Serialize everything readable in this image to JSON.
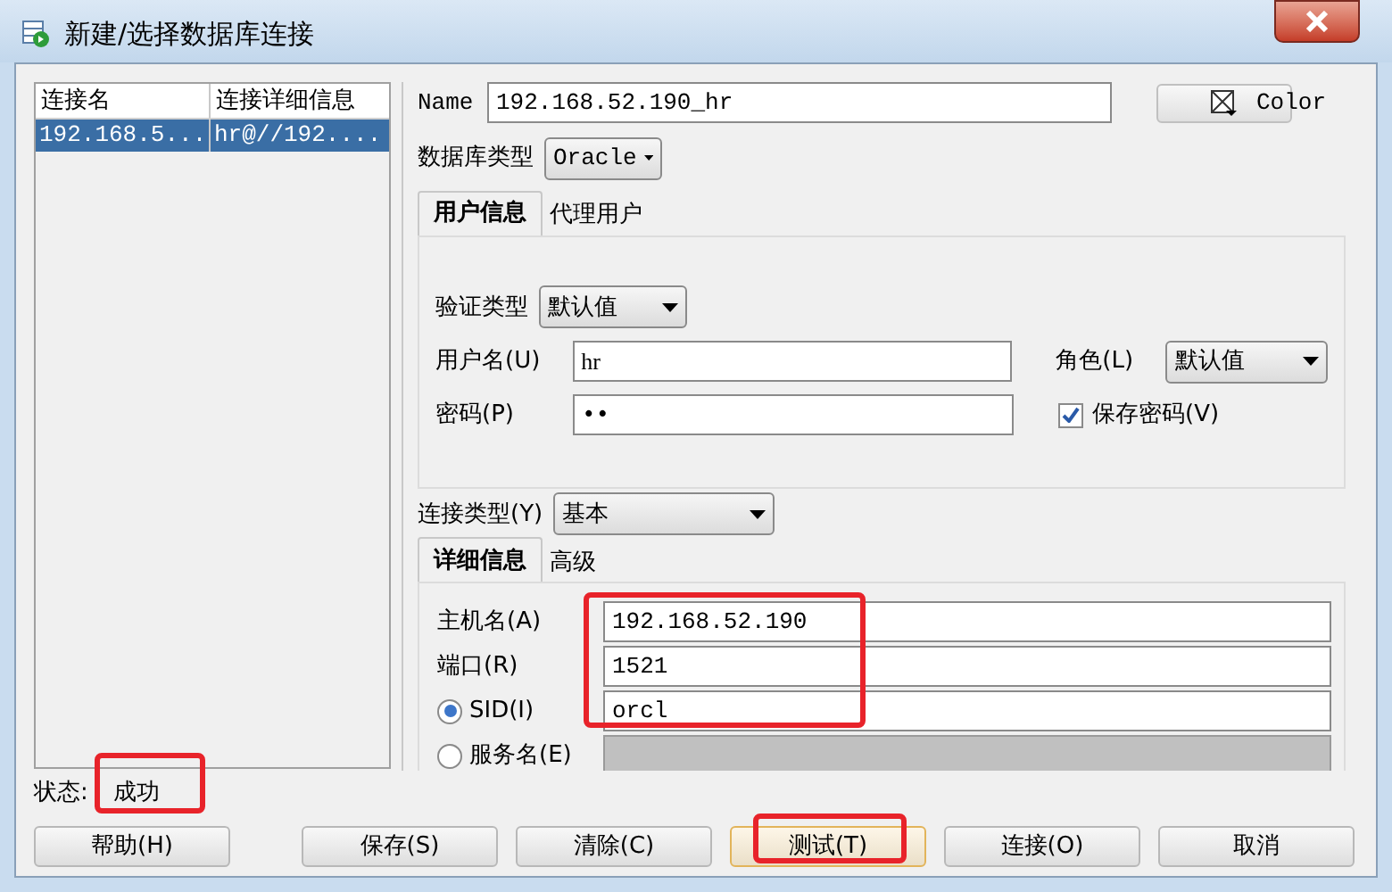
{
  "window": {
    "title": "新建/选择数据库连接"
  },
  "connections": {
    "columns": [
      "连接名",
      "连接详细信息"
    ],
    "rows": [
      {
        "cells": [
          "192.168.5...",
          "hr@//192...."
        ],
        "selected": true
      }
    ]
  },
  "name": {
    "label": "Name",
    "value": "192.168.52.190_hr"
  },
  "color_button": {
    "label": "Color"
  },
  "db_type": {
    "label": "数据库类型",
    "value": "Oracle"
  },
  "user_tabs": [
    {
      "label": "用户信息",
      "selected": true
    },
    {
      "label": "代理用户",
      "selected": false
    }
  ],
  "auth_type": {
    "label": "验证类型",
    "value": "默认值"
  },
  "username": {
    "label": "用户名(U)",
    "value": "hr"
  },
  "role": {
    "label": "角色(L)",
    "value": "默认值"
  },
  "password": {
    "label": "密码(P)",
    "value": "••"
  },
  "save_password": {
    "label": "保存密码(V)",
    "checked": true
  },
  "conn_type": {
    "label": "连接类型(Y)",
    "value": "基本"
  },
  "detail_tabs": [
    {
      "label": "详细信息",
      "selected": true
    },
    {
      "label": "高级",
      "selected": false
    }
  ],
  "host": {
    "label": "主机名(A)",
    "value": "192.168.52.190"
  },
  "port": {
    "label": "端口(R)",
    "value": "1521"
  },
  "sid_options": [
    {
      "label": "SID(I)",
      "value": "orcl",
      "selected": true
    },
    {
      "label": "服务名(E)",
      "selected": false
    }
  ],
  "status": {
    "label": "状态:",
    "value": "成功"
  },
  "buttons": [
    {
      "label": "帮助(H)",
      "focused": false
    },
    {
      "label": "保存(S)",
      "focused": false
    },
    {
      "label": "清除(C)",
      "focused": false
    },
    {
      "label": "测试(T)",
      "focused": true
    },
    {
      "label": "连接(O)",
      "focused": false
    },
    {
      "label": "取消",
      "focused": false
    }
  ]
}
